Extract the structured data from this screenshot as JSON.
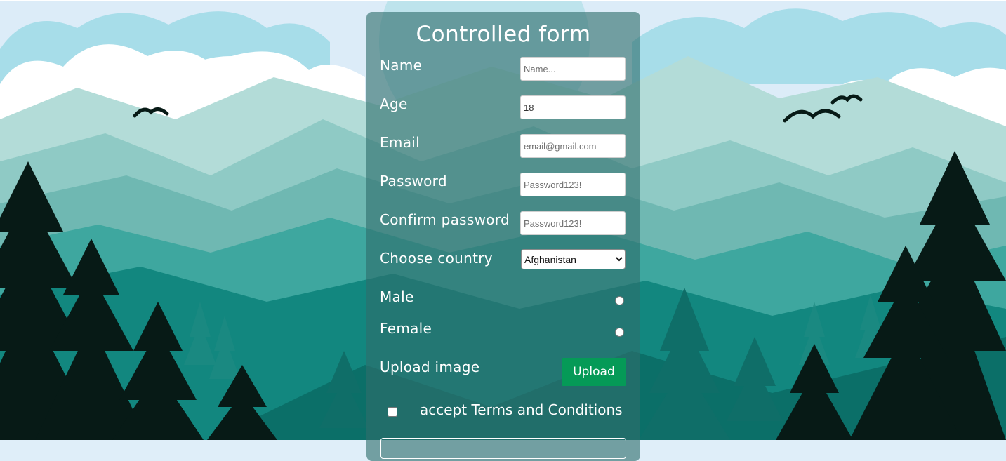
{
  "form": {
    "title": "Controlled form",
    "fields": {
      "name": {
        "label": "Name",
        "placeholder": "Name...",
        "value": ""
      },
      "age": {
        "label": "Age",
        "value": "18"
      },
      "email": {
        "label": "Email",
        "placeholder": "email@gmail.com",
        "value": ""
      },
      "password": {
        "label": "Password",
        "placeholder": "Password123!",
        "value": ""
      },
      "confirm_password": {
        "label": "Confirm password",
        "placeholder": "Password123!",
        "value": ""
      },
      "country": {
        "label": "Choose country",
        "selected": "Afghanistan"
      }
    },
    "gender": {
      "male_label": "Male",
      "female_label": "Female"
    },
    "upload": {
      "label": "Upload image",
      "button_label": "Upload"
    },
    "terms": {
      "label": "accept Terms and Conditions"
    }
  },
  "colors": {
    "card": "#2e6e6c",
    "upload_button": "#059a57",
    "sky": "#dfeef9",
    "trees": "#071a16"
  },
  "icons": [
    "bird-icon",
    "pine-tree-icon",
    "cloud-icon",
    "mountain-icon"
  ]
}
